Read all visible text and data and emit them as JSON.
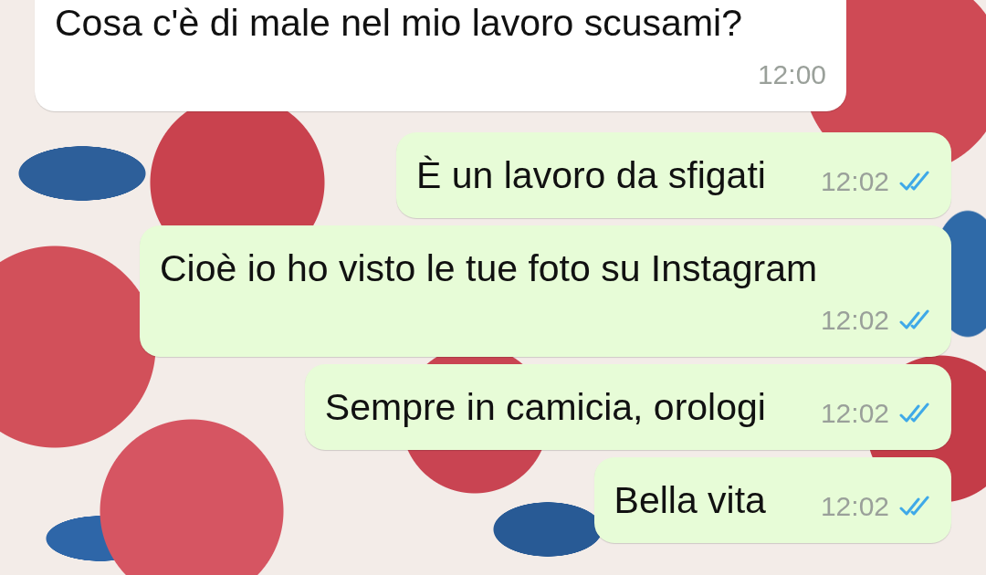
{
  "messages": [
    {
      "kind": "incoming",
      "text": "Cosa c'è di male nel mio lavoro scusami?",
      "time": "12:00"
    },
    {
      "kind": "outgoing",
      "text": "È un lavoro da sfigati",
      "time": "12:02",
      "read": true
    },
    {
      "kind": "outgoing",
      "text": "Cioè io ho visto le tue foto su Instagram",
      "time": "12:02",
      "read": true
    },
    {
      "kind": "outgoing",
      "text": "Sempre in camicia, orologi",
      "time": "12:02",
      "read": true
    },
    {
      "kind": "outgoing",
      "text": "Bella vita",
      "time": "12:02",
      "read": true
    }
  ]
}
